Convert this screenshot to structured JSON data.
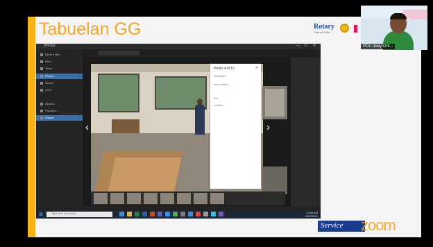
{
  "slide": {
    "title": "Tabuelan GG",
    "logo_word": "Rotary",
    "logo_sub": "Club of Cebu",
    "accent_color": "#f5a623"
  },
  "video": {
    "participant_name": "PCC Joey Orti..."
  },
  "window": {
    "title": "Photos",
    "controls": "— ☐ ✕"
  },
  "sidebar": {
    "items": [
      "Recent files",
      "Files",
      "Team",
      "Photos",
      "Videos",
      "Links",
      "Albums",
      "Favorites",
      "Shared",
      "People"
    ]
  },
  "info_panel": {
    "title": "Photo 4 of 10",
    "close": "✕",
    "lines": [
      "Description",
      "Last modified",
      "Size",
      "Location"
    ]
  },
  "taskbar": {
    "search_placeholder": "Type here to search",
    "time": "10:46 AM",
    "date": "6/12/2021"
  },
  "footer": {
    "service_text": "Service",
    "zoom_text": "zoom"
  },
  "icons": {
    "prev": "‹",
    "next": "›",
    "start": "⊞"
  }
}
